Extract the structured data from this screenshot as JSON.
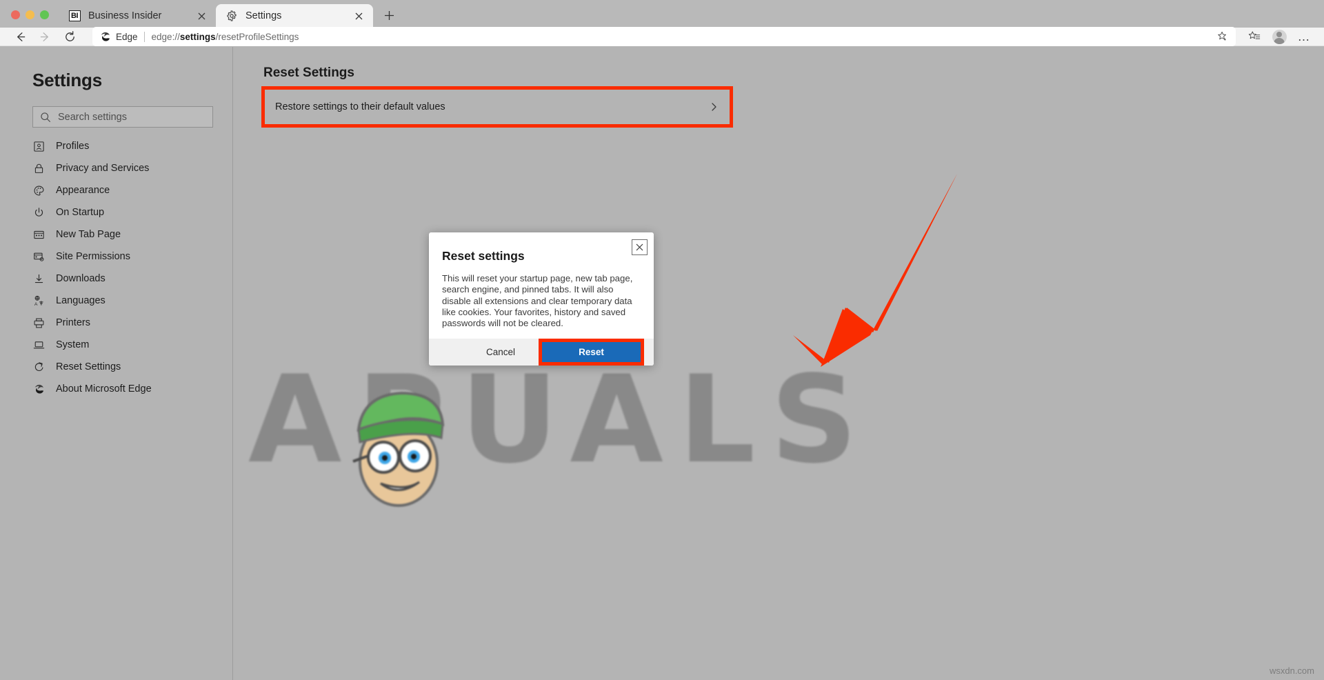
{
  "window": {
    "traffic_lights": [
      "close",
      "minimize",
      "maximize"
    ]
  },
  "tabs": [
    {
      "title": "Business Insider",
      "favicon": "business-insider-icon",
      "favicon_text": "BI",
      "active": false
    },
    {
      "title": "Settings",
      "favicon": "gear-icon",
      "favicon_text": "",
      "active": true
    }
  ],
  "new_tab_label": "+",
  "toolbar": {
    "back_label": "Back",
    "forward_label": "Forward",
    "reload_label": "Reload",
    "edge_label": "Edge",
    "url_prefix": "edge://",
    "url_bold": "settings",
    "url_suffix": "/resetProfileSettings",
    "favorite_icon": "star-plus-icon",
    "favorites_icon": "favorites-list-icon",
    "profile_icon": "avatar-icon",
    "more_icon": "more-options-icon",
    "more_label": "…"
  },
  "sidebar": {
    "heading": "Settings",
    "search_placeholder": "Search settings",
    "items": [
      {
        "label": "Profiles",
        "icon": "profile-card-icon"
      },
      {
        "label": "Privacy and Services",
        "icon": "lock-icon"
      },
      {
        "label": "Appearance",
        "icon": "palette-icon"
      },
      {
        "label": "On Startup",
        "icon": "power-icon"
      },
      {
        "label": "New Tab Page",
        "icon": "new-tab-page-icon"
      },
      {
        "label": "Site Permissions",
        "icon": "site-permissions-icon"
      },
      {
        "label": "Downloads",
        "icon": "download-arrow-icon"
      },
      {
        "label": "Languages",
        "icon": "languages-icon"
      },
      {
        "label": "Printers",
        "icon": "printer-icon"
      },
      {
        "label": "System",
        "icon": "laptop-icon"
      },
      {
        "label": "Reset Settings",
        "icon": "reset-circular-arrow-icon"
      },
      {
        "label": "About Microsoft Edge",
        "icon": "edge-logo-icon"
      }
    ]
  },
  "main": {
    "title": "Reset Settings",
    "restore_row_label": "Restore settings to their default values",
    "chevron_icon": "chevron-right-icon"
  },
  "dialog": {
    "title": "Reset settings",
    "body": "This will reset your startup page, new tab page, search engine, and pinned tabs. It will also disable all extensions and clear temporary data like cookies. Your favorites, history and saved passwords will not be cleared.",
    "close_icon": "close-icon",
    "close_label": "✕",
    "cancel_label": "Cancel",
    "reset_label": "Reset"
  },
  "annotations": {
    "highlight_color": "#fa2c00",
    "arrow_color": "#fa2c00",
    "primary_button_color": "#1a6ab8"
  },
  "watermark": {
    "brand_text": "APUALS",
    "site_text": "wsxdn.com"
  }
}
